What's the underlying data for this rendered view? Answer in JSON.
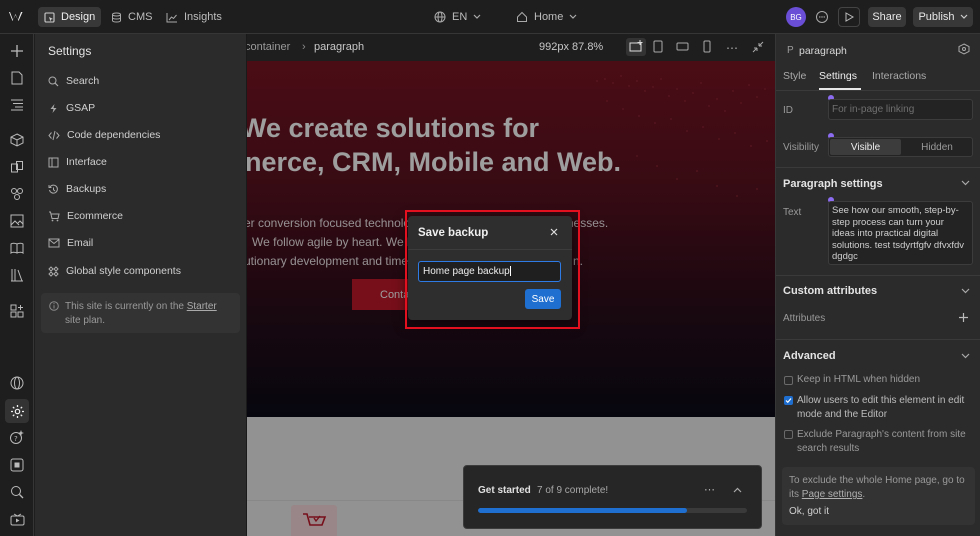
{
  "topbar": {
    "tabs": [
      {
        "label": "Design",
        "icon": "design-icon"
      },
      {
        "label": "CMS",
        "icon": "database-icon"
      },
      {
        "label": "Insights",
        "icon": "chart-icon"
      }
    ],
    "locale": "EN",
    "page": "Home",
    "avatar": "BG",
    "share": "Share",
    "publish": "Publish"
  },
  "settings": {
    "title": "Settings",
    "items": [
      {
        "label": "Search",
        "icon": "search-icon"
      },
      {
        "label": "GSAP",
        "icon": "bolt-icon"
      },
      {
        "label": "Code dependencies",
        "icon": "code-icon"
      },
      {
        "label": "Interface",
        "icon": "layout-icon"
      },
      {
        "label": "Backups",
        "icon": "history-icon"
      },
      {
        "label": "Ecommerce",
        "icon": "cart-icon"
      },
      {
        "label": "Email",
        "icon": "mail-icon"
      },
      {
        "label": "Global style components",
        "icon": "components-icon"
      }
    ],
    "plan_notice_pre": "This site is currently on the ",
    "plan_link": "Starter",
    "plan_notice_post": "site plan."
  },
  "canvas": {
    "breadcrumb_1": "container",
    "breadcrumb_2": "paragraph",
    "viewport": "992px 87.8%",
    "hero_title_1": "We create solutions for",
    "hero_title_2": "nerce, CRM, Mobile and Web.",
    "hero_text_1": "er conversion focused technology solutions to ambitious businesses.",
    "hero_text_2": "We follow agile by heart. We believe in adaptive planning,",
    "hero_text_3": "utionary development and time",
    "hero_text_3b": "n.",
    "cta": "Conta"
  },
  "modal": {
    "title": "Save backup",
    "input_value": "Home page backup",
    "save": "Save"
  },
  "get_started": {
    "label": "Get started",
    "progress_text": "7 of 9 complete!",
    "completed": 7,
    "total": 9
  },
  "right_panel": {
    "element_type": "P",
    "element_name": "paragraph",
    "tabs": [
      "Style",
      "Settings",
      "Interactions"
    ],
    "id_label": "ID",
    "id_placeholder": "For in-page linking",
    "visibility_label": "Visibility",
    "visible": "Visible",
    "hidden": "Hidden",
    "paragraph_settings": "Paragraph settings",
    "text_label": "Text",
    "text_value": "See how our smooth, step-by-step process can turn your ideas into practical digital solutions. test tsdyrtfgfv dfvxfdv dgdgc",
    "custom_attributes": "Custom attributes",
    "attributes": "Attributes",
    "advanced": "Advanced",
    "opt_keep_html": "Keep in HTML when hidden",
    "opt_allow_edit": "Allow users to edit this element in edit mode and the Editor",
    "opt_exclude": "Exclude Paragraph's content from site search results",
    "opt_keep_html_checked": false,
    "opt_allow_edit_checked": true,
    "opt_exclude_checked": false,
    "footer_notice_pre": "To exclude the whole Home page, go to its ",
    "footer_link": "Page settings",
    "footer_notice_post": ".",
    "ok_got_it": "Ok, got it"
  },
  "colors": {
    "accent": "#1f6fd1",
    "highlight": "#e3101f",
    "hero_red": "#7a1523"
  }
}
